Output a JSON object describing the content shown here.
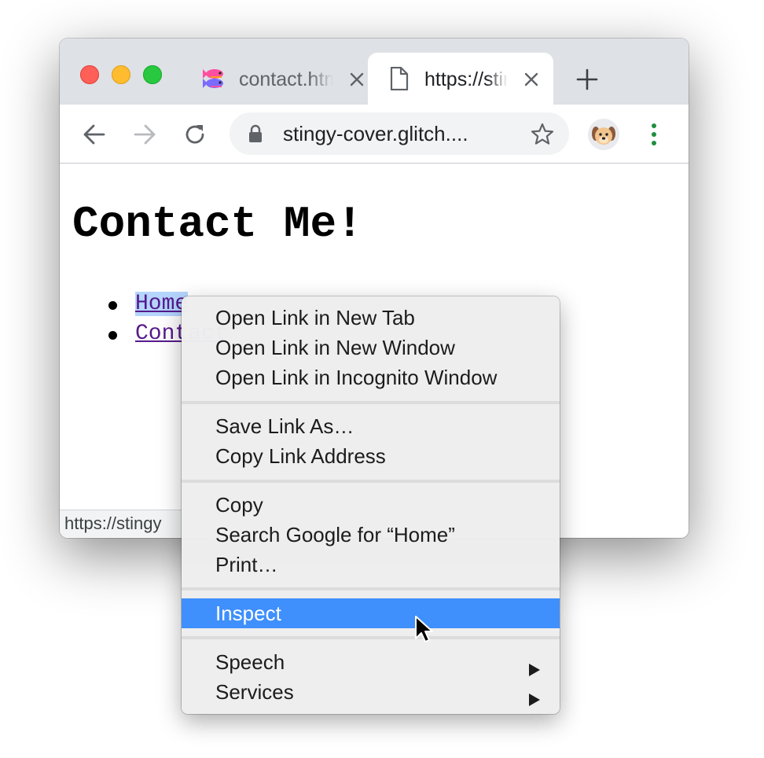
{
  "browser": {
    "tabs": [
      {
        "title": "contact.html",
        "icon": "fish-favicon",
        "active": false
      },
      {
        "title": "https://stingy-cover.glitch.me/contact.html",
        "icon": "page-icon",
        "active": true
      }
    ],
    "new_tab_icon": "plus-icon",
    "toolbar": {
      "back_icon": "back-arrow-icon",
      "forward_icon": "forward-arrow-icon",
      "reload_icon": "reload-icon",
      "url": "stingy-cover.glitch....",
      "lock_icon": "lock-icon",
      "bookmark_icon": "star-icon",
      "avatar": "dog-avatar-icon",
      "menu_icon": "kebab-menu-icon"
    },
    "status_url": "https://stingy"
  },
  "page": {
    "heading": "Contact Me!",
    "links": [
      {
        "label": "Home",
        "selected": true
      },
      {
        "label": "Contact",
        "selected": false
      }
    ]
  },
  "context_menu": {
    "groups": [
      [
        "Open Link in New Tab",
        "Open Link in New Window",
        "Open Link in Incognito Window"
      ],
      [
        "Save Link As…",
        "Copy Link Address"
      ],
      [
        "Copy",
        "Search Google for “Home”",
        "Print…"
      ],
      [
        "Inspect"
      ],
      [
        "Speech",
        "Services"
      ]
    ],
    "highlighted_item": "Inspect",
    "submenu_items": [
      "Speech",
      "Services"
    ]
  },
  "colors": {
    "tabstrip_bg": "#dee1e6",
    "highlight": "#3f8ffc",
    "link": "#551a8b",
    "selection": "#b4d5fe",
    "menu_dots": "#1e8e3e"
  }
}
